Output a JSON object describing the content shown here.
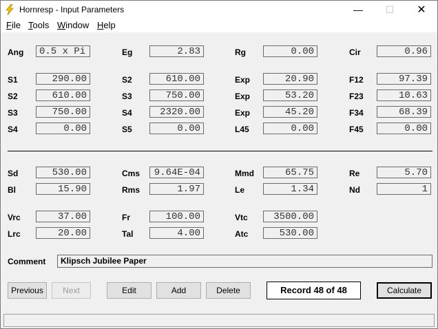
{
  "window": {
    "title": "Hornresp - Input Parameters",
    "minimize": "—",
    "maximize": "☐",
    "close": "✕"
  },
  "menu": [
    {
      "key": "F",
      "rest": "ile"
    },
    {
      "key": "T",
      "rest": "ools"
    },
    {
      "key": "W",
      "rest": "indow"
    },
    {
      "key": "H",
      "rest": "elp"
    }
  ],
  "params": {
    "ang": {
      "label": "Ang",
      "value": "0.5 x Pi"
    },
    "eg": {
      "label": "Eg",
      "value": "2.83"
    },
    "rg": {
      "label": "Rg",
      "value": "0.00"
    },
    "cir": {
      "label": "Cir",
      "value": "0.96"
    },
    "s1a": {
      "label": "S1",
      "value": "290.00"
    },
    "s2a": {
      "label": "S2",
      "value": "610.00"
    },
    "exp1": {
      "label": "Exp",
      "value": "20.90"
    },
    "f12": {
      "label": "F12",
      "value": "97.39"
    },
    "s2b": {
      "label": "S2",
      "value": "610.00"
    },
    "s3a": {
      "label": "S3",
      "value": "750.00"
    },
    "exp2": {
      "label": "Exp",
      "value": "53.20"
    },
    "f23": {
      "label": "F23",
      "value": "10.63"
    },
    "s3b": {
      "label": "S3",
      "value": "750.00"
    },
    "s4a": {
      "label": "S4",
      "value": "2320.00"
    },
    "exp3": {
      "label": "Exp",
      "value": "45.20"
    },
    "f34": {
      "label": "F34",
      "value": "68.39"
    },
    "s4b": {
      "label": "S4",
      "value": "0.00"
    },
    "s5": {
      "label": "S5",
      "value": "0.00"
    },
    "l45": {
      "label": "L45",
      "value": "0.00"
    },
    "f45": {
      "label": "F45",
      "value": "0.00"
    },
    "sd": {
      "label": "Sd",
      "value": "530.00"
    },
    "cms": {
      "label": "Cms",
      "value": "9.64E-04"
    },
    "mmd": {
      "label": "Mmd",
      "value": "65.75"
    },
    "re": {
      "label": "Re",
      "value": "5.70"
    },
    "bl": {
      "label": "Bl",
      "value": "15.90"
    },
    "rms": {
      "label": "Rms",
      "value": "1.97"
    },
    "le": {
      "label": "Le",
      "value": "1.34"
    },
    "nd": {
      "label": "Nd",
      "value": "1"
    },
    "vrc": {
      "label": "Vrc",
      "value": "37.00"
    },
    "fr": {
      "label": "Fr",
      "value": "100.00"
    },
    "vtc": {
      "label": "Vtc",
      "value": "3500.00"
    },
    "lrc": {
      "label": "Lrc",
      "value": "20.00"
    },
    "tal": {
      "label": "Tal",
      "value": "4.00"
    },
    "atc": {
      "label": "Atc",
      "value": "530.00"
    }
  },
  "comment": {
    "label": "Comment",
    "value": "Klipsch Jubilee Paper"
  },
  "buttons": {
    "previous": "Previous",
    "next": "Next",
    "edit": "Edit",
    "add": "Add",
    "delete": "Delete",
    "calculate": "Calculate"
  },
  "record": "Record 48 of 48",
  "colors": {
    "icon": "#f2c200",
    "background": "#f0f0f0"
  }
}
